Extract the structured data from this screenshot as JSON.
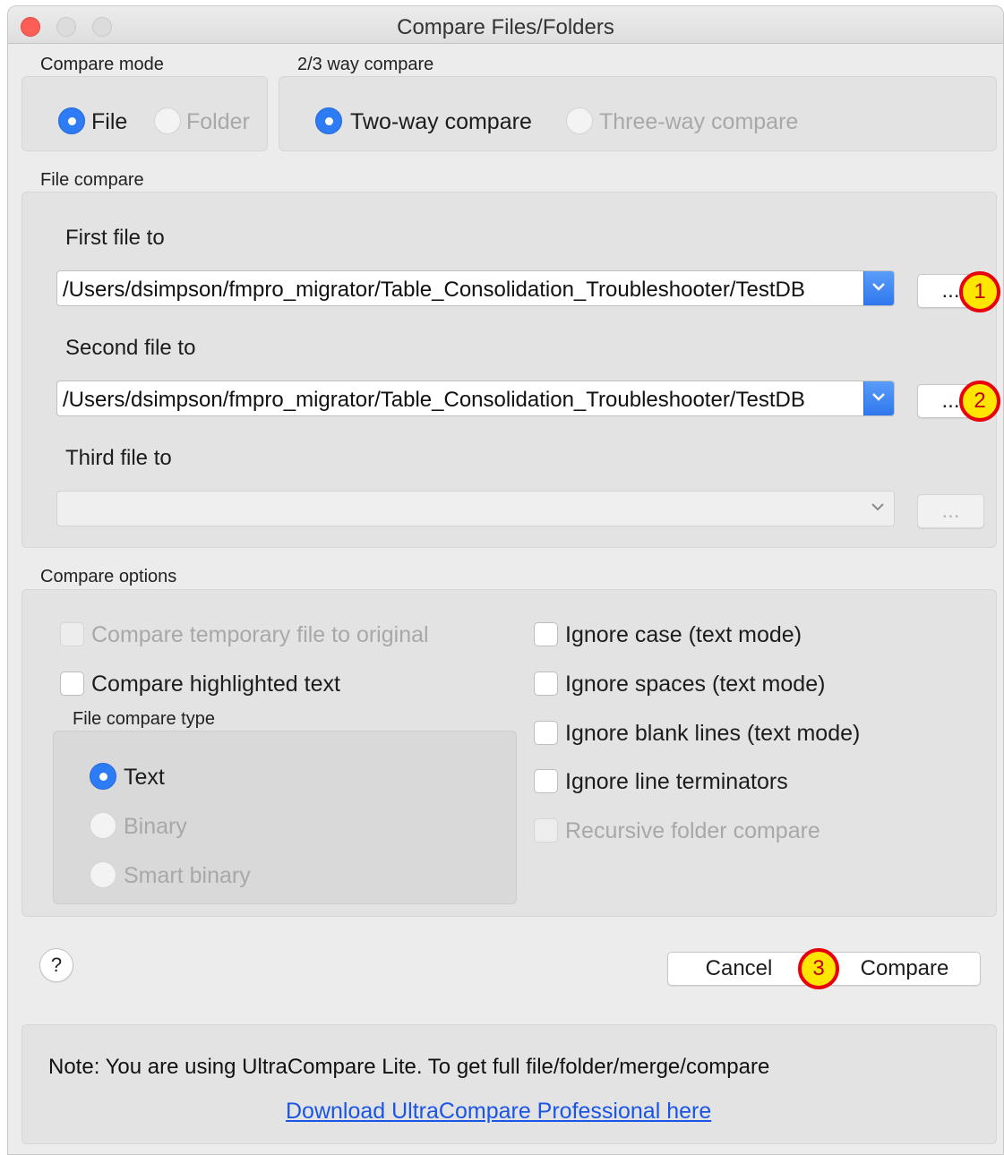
{
  "window": {
    "title": "Compare Files/Folders"
  },
  "compare_mode": {
    "label": "Compare mode",
    "options": [
      {
        "label": "File",
        "selected": true,
        "enabled": true
      },
      {
        "label": "Folder",
        "selected": false,
        "enabled": false
      }
    ]
  },
  "way_compare": {
    "label": "2/3 way compare",
    "options": [
      {
        "label": "Two-way compare",
        "selected": true,
        "enabled": true
      },
      {
        "label": "Three-way compare",
        "selected": false,
        "enabled": false
      }
    ]
  },
  "file_compare": {
    "label": "File compare",
    "first": {
      "label": "First file to",
      "value": "/Users/dsimpson/fmpro_migrator/Table_Consolidation_Troubleshooter/TestDB",
      "browse_label": "..."
    },
    "second": {
      "label": "Second file to",
      "value": "/Users/dsimpson/fmpro_migrator/Table_Consolidation_Troubleshooter/TestDB",
      "browse_label": "..."
    },
    "third": {
      "label": "Third file to",
      "value": "",
      "browse_label": "...",
      "enabled": false
    }
  },
  "compare_options": {
    "label": "Compare options",
    "left": [
      {
        "label": "Compare temporary file to original",
        "checked": false,
        "enabled": false
      },
      {
        "label": "Compare highlighted text",
        "checked": false,
        "enabled": true
      }
    ],
    "right": [
      {
        "label": "Ignore case (text mode)",
        "checked": false,
        "enabled": true
      },
      {
        "label": "Ignore spaces (text mode)",
        "checked": false,
        "enabled": true
      },
      {
        "label": "Ignore blank lines (text mode)",
        "checked": false,
        "enabled": true
      },
      {
        "label": "Ignore line terminators",
        "checked": false,
        "enabled": true
      },
      {
        "label": "Recursive folder compare",
        "checked": false,
        "enabled": false
      }
    ],
    "file_compare_type": {
      "label": "File compare type",
      "options": [
        {
          "label": "Text",
          "selected": true,
          "enabled": true
        },
        {
          "label": "Binary",
          "selected": false,
          "enabled": false
        },
        {
          "label": "Smart binary",
          "selected": false,
          "enabled": false
        }
      ]
    }
  },
  "buttons": {
    "help": "?",
    "cancel": "Cancel",
    "compare": "Compare"
  },
  "annotations": [
    "1",
    "2",
    "3"
  ],
  "note": {
    "text": "Note: You are using UltraCompare Lite. To get full file/folder/merge/compare",
    "link": "Download UltraCompare Professional here"
  },
  "colors": {
    "accent": "#2d7cf6",
    "badge_fill": "#ffe600",
    "badge_ring": "#e8000b",
    "link": "#1a55e6"
  }
}
